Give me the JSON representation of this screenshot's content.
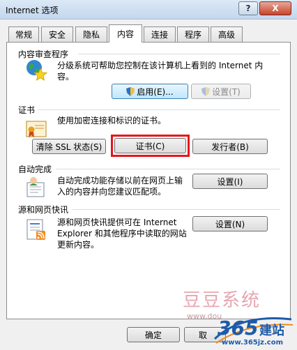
{
  "window": {
    "title": "Internet 选项",
    "help_label": "?",
    "close_label": "X"
  },
  "tabs": [
    "常规",
    "安全",
    "隐私",
    "内容",
    "连接",
    "程序",
    "高级"
  ],
  "active_tab": "内容",
  "content_advisor": {
    "heading": "内容审查程序",
    "description_line1": "分级系统可帮助您控制在该计算机上看到的 Internet 内",
    "description_line2": "容。",
    "enable_label": "启用(E)...",
    "settings_label": "设置(T)"
  },
  "certificates": {
    "heading": "证书",
    "description": "使用加密连接和标识的证书。",
    "clear_ssl_label": "清除 SSL 状态(S)",
    "certificates_label": "证书(C)",
    "publishers_label": "发行者(B)"
  },
  "autocomplete": {
    "heading": "自动完成",
    "description_line1": "自动完成功能存储以前在网页上输",
    "description_line2": "入的内容并向您建议匹配项。",
    "settings_label": "设置(I)"
  },
  "feeds": {
    "heading": "源和网页快讯",
    "description_line1": "源和网页快讯提供可在 Internet",
    "description_line2": "Explorer 和其他程序中读取的网站",
    "description_line3": "更新内容。",
    "settings_label": "设置(N)"
  },
  "footer": {
    "ok_label": "确定",
    "cancel_label": "取"
  },
  "watermark": {
    "site_name": "豆豆系统",
    "partial_url": "www.dou",
    "brand_number": "365",
    "brand_text": "建站",
    "brand_url": "www.365jz.com"
  },
  "colors": {
    "highlight": "#e8141c",
    "watermark": "#e7a6b1",
    "brand_blue": "#1e5ba8",
    "brand_orange": "#f08a1c"
  }
}
